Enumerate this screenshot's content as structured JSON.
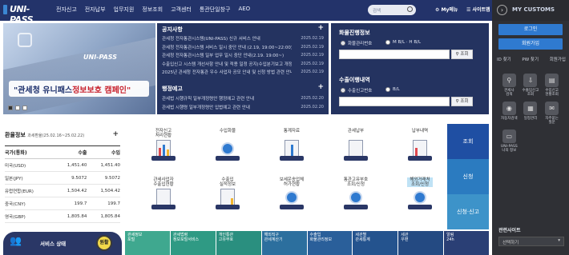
{
  "header": {
    "logo_text": "UNI-PASS",
    "nav": [
      "전자신고",
      "전자납부",
      "업무지원",
      "정보조회",
      "고객센터",
      "통관단일창구",
      "AEO"
    ],
    "search_placeholder": "검색",
    "my_menu": "My메뉴",
    "sitemap": "사이트맵"
  },
  "right_panel": {
    "title": "MY CUSTOMS",
    "login_button": "로그인",
    "signup_button": "회원가입",
    "links": [
      "ID 찾기",
      "PW 찾기",
      "회원가입"
    ],
    "shortcuts": [
      {
        "label": "관세사\n검색",
        "icon": "person-search-icon"
      },
      {
        "label": "수출입신고\n조회",
        "icon": "download-icon"
      },
      {
        "label": "수입신고\n현황조회",
        "icon": "document-icon"
      },
      {
        "label": "자동차검색",
        "icon": "eye-icon"
      },
      {
        "label": "일정관리",
        "icon": "calendar-icon"
      },
      {
        "label": "자주묻는\n질문",
        "icon": "chat-icon"
      },
      {
        "label": "UNI-PASS\n나의 정보",
        "icon": "id-card-icon"
      }
    ],
    "related_sites_title": "관련사이트",
    "related_sites_select": "선택하기"
  },
  "banner": {
    "emblem_text": "UNI-PASS",
    "caption_a": "\"관세청 유니패스 ",
    "caption_b": "정보보호 캠페인\""
  },
  "notices": {
    "title": "공지사항",
    "items": [
      {
        "title": "관세청 전자통관시스템(UNI-PASS) 신규 서비스 안내",
        "date": "2025.02.19"
      },
      {
        "title": "관세청 전자통관시스템 서비스 일시 중단 안내 (2.19, 19:00~22:00)",
        "date": "2025.02.19"
      },
      {
        "title": "관세청 전자통관시스템 일부 업무 일시 중단 안내(2.19. 19:00~)",
        "date": "2025.02.19"
      },
      {
        "title": "수출입신고 시스템 개선사항 안내 및 적용 일정 공지(수입분기보고 개정 공고 13202...",
        "date": "2025.02.19"
      },
      {
        "title": "2025년 관세청 전자통관 우수 사업자 공모 안내 및 신청 방법 관련 안내 (종료)",
        "date": "2025.02.19"
      }
    ],
    "events_title": "행정예고",
    "events": [
      {
        "title": "관세법 시행규칙 일부개정령안 행정예고 관련 안내",
        "date": "2025.02.20"
      },
      {
        "title": "관세법 시행령 일부개정령안 입법예고 관련 안내",
        "date": "2025.02.20"
      }
    ]
  },
  "fx": {
    "title": "화물진행정보",
    "radio_a": "화물관리번호",
    "radio_b": "M B/L · H B/L",
    "query_button": "조회",
    "title2": "수출이행내역",
    "radio_c": "수출신고번호",
    "radio_d": "B/L",
    "query_button2": "조회"
  },
  "rates": {
    "title": "환율정보",
    "subtitle": "과세환율(25.02.16~25.02.22)",
    "col_country": "국가(통화)",
    "col_export": "수출",
    "col_import": "수입",
    "rows": [
      {
        "country": "미국(USD)",
        "export": "1,451.40",
        "import": "1,451.40"
      },
      {
        "country": "일본(JPY)",
        "export": "9.5072",
        "import": "9.5072"
      },
      {
        "country": "유럽연합(EUR)",
        "export": "1,504.42",
        "import": "1,504.42"
      },
      {
        "country": "중국(CNY)",
        "export": "199.7",
        "import": "199.7"
      },
      {
        "country": "영국(GBP)",
        "export": "1,805.84",
        "import": "1,805.84"
      }
    ]
  },
  "service_status": {
    "label": "서비스 상태",
    "state": "원활"
  },
  "services": [
    {
      "label": "전자신고\n처리현황",
      "highlight": false
    },
    {
      "label": "수입화물",
      "highlight": false
    },
    {
      "label": "통계자료",
      "highlight": false
    },
    {
      "label": "관세납부",
      "highlight": false
    },
    {
      "label": "납부내역",
      "highlight": false
    },
    {
      "label": "관세사업자\n수출입현황",
      "highlight": false
    },
    {
      "label": "수출입\n실적정보",
      "highlight": false
    },
    {
      "label": "보세운송업체\n허가현황",
      "highlight": false
    },
    {
      "label": "통관고유부호\n조회/신청",
      "highlight": false
    },
    {
      "label": "해외거래처\n조회/신청",
      "highlight": true
    }
  ],
  "side_tabs": [
    "조회",
    "신청",
    "신청·신고"
  ],
  "strip": [
    {
      "label": "관세정보\n포털",
      "color": "#3fa88f"
    },
    {
      "label": "관세법령\n정보포털서비스",
      "color": "#2f9a84"
    },
    {
      "label": "개인통관\n고유부호",
      "color": "#2a8f7f"
    },
    {
      "label": "해외직구\n관세계산기",
      "color": "#2c6f9e"
    },
    {
      "label": "수출입\n화물관리정보",
      "color": "#2a5f9a"
    },
    {
      "label": "세관별\n관세통계",
      "color": "#24538e"
    },
    {
      "label": "세관\n우편",
      "color": "#244a82"
    },
    {
      "label": "알림\n24h",
      "color": "#2a3f75"
    }
  ],
  "colors": {
    "navy": "#23336a",
    "blue": "#2f7ad0",
    "dark": "#2f3035"
  }
}
